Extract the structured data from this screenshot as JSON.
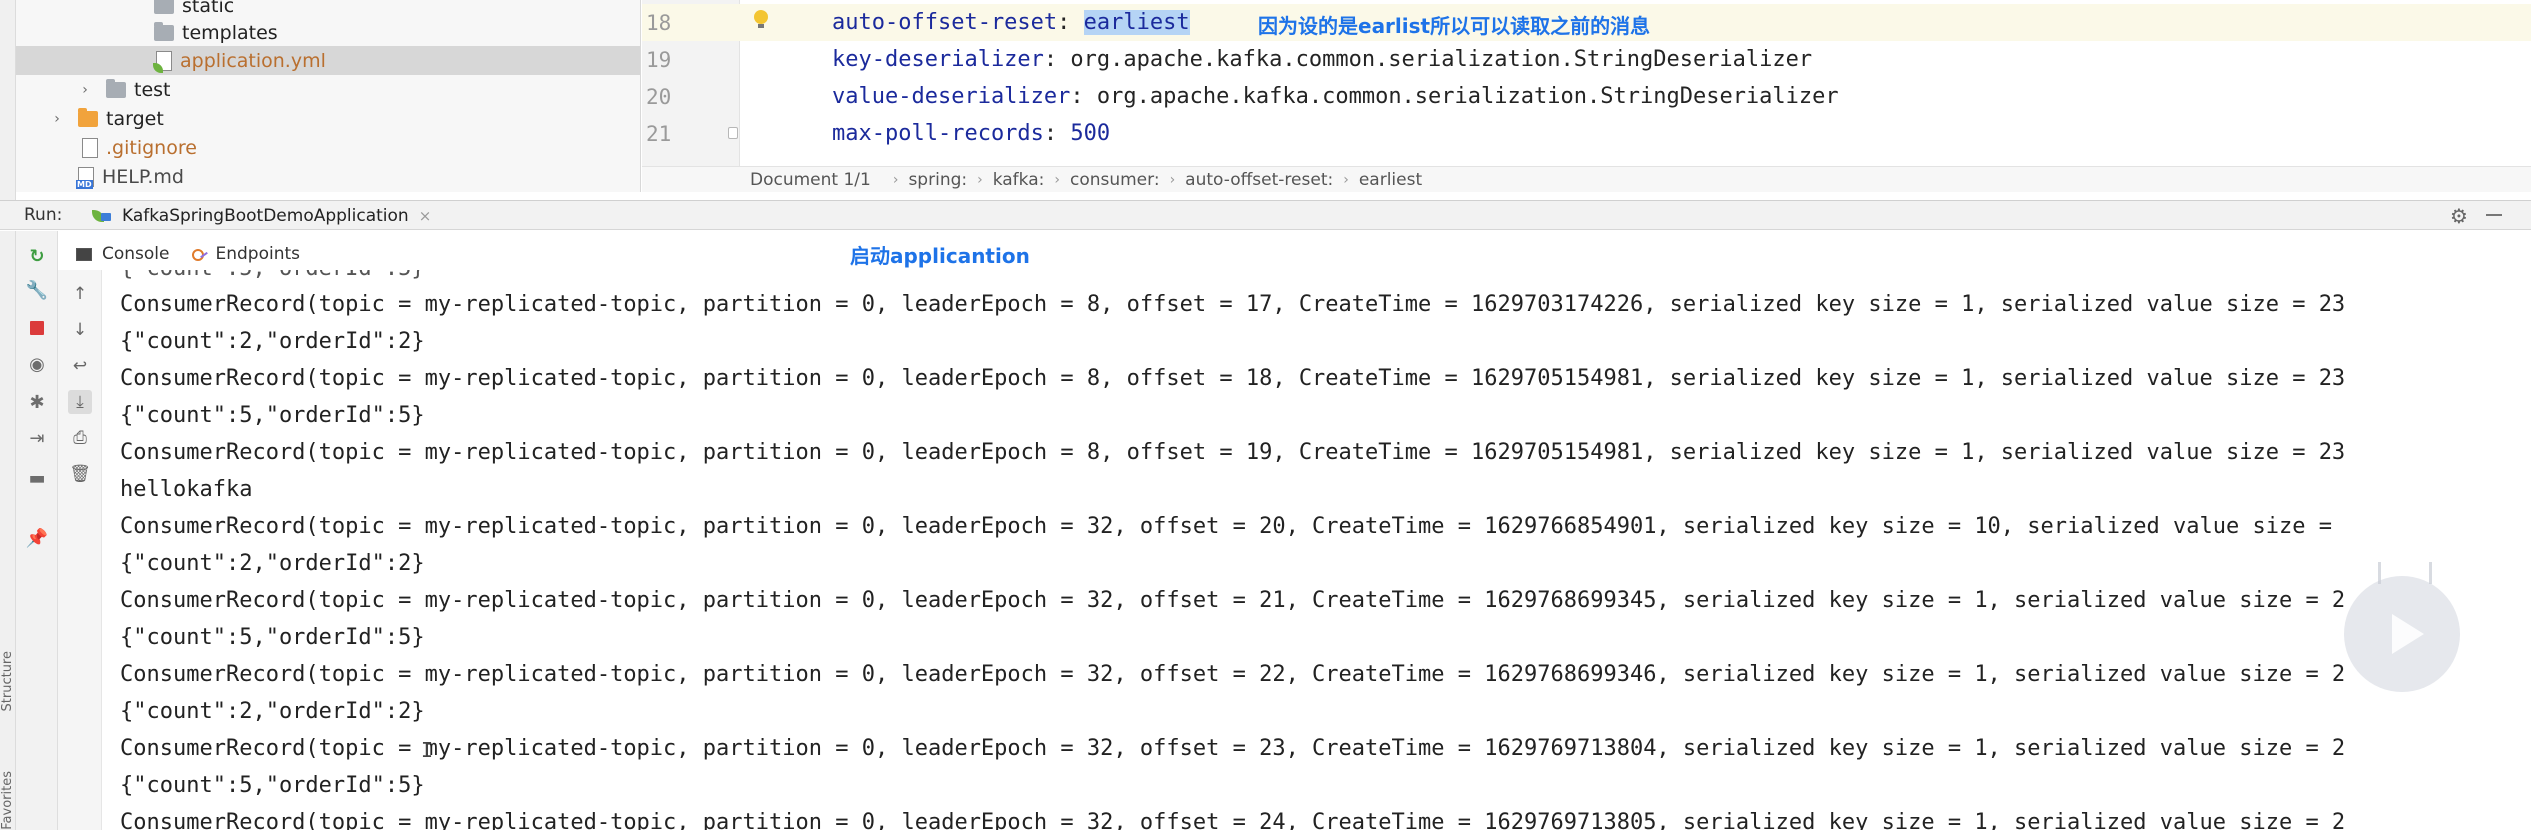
{
  "project_tree": {
    "items": [
      {
        "label": "static",
        "kind": "folder-grey",
        "arrow": ""
      },
      {
        "label": "templates",
        "kind": "folder-grey",
        "arrow": ""
      },
      {
        "label": "application.yml",
        "kind": "yml-file",
        "arrow": ""
      },
      {
        "label": "test",
        "kind": "folder-grey",
        "arrow": "›"
      },
      {
        "label": "target",
        "kind": "folder-orange",
        "arrow": "›"
      },
      {
        "label": ".gitignore",
        "kind": "git-file",
        "arrow": ""
      },
      {
        "label": "HELP.md",
        "kind": "md-file",
        "arrow": ""
      }
    ]
  },
  "editor": {
    "lines": [
      {
        "num": "18",
        "key": "auto-offset-reset",
        "value": "earliest"
      },
      {
        "num": "19",
        "key": "key-deserializer",
        "value": "org.apache.kafka.common.serialization.StringDeserializer"
      },
      {
        "num": "20",
        "key": "value-deserializer",
        "value": "org.apache.kafka.common.serialization.StringDeserializer"
      },
      {
        "num": "21",
        "key": "max-poll-records",
        "value": "500"
      }
    ],
    "annotation": "因为设的是earlist所以可以读取之前的消息"
  },
  "breadcrumb": {
    "document": "Document 1/1",
    "items": [
      "spring:",
      "kafka:",
      "consumer:",
      "auto-offset-reset:",
      "earliest"
    ]
  },
  "run": {
    "label": "Run:",
    "tab_label": "KafkaSpringBootDemoApplication",
    "close": "×",
    "gear_icon": "gear-icon",
    "minimize_icon": "minimize-icon"
  },
  "console_tabs": {
    "console": "Console",
    "endpoints": "Endpoints",
    "annotation": "启动applicantion"
  },
  "left_strip": {
    "structure": "Structure",
    "favorites": "Favorites"
  },
  "console": {
    "lines": [
      "ConsumerRecord(topic = my-replicated-topic, partition = 0, leaderEpoch = 8, offset = 17, CreateTime = 1629703174226, serialized key size = 1, serialized value size = 23",
      "{\"count\":2,\"orderId\":2}",
      "ConsumerRecord(topic = my-replicated-topic, partition = 0, leaderEpoch = 8, offset = 18, CreateTime = 1629705154981, serialized key size = 1, serialized value size = 23",
      "{\"count\":5,\"orderId\":5}",
      "ConsumerRecord(topic = my-replicated-topic, partition = 0, leaderEpoch = 8, offset = 19, CreateTime = 1629705154981, serialized key size = 1, serialized value size = 23",
      "hellokafka",
      "ConsumerRecord(topic = my-replicated-topic, partition = 0, leaderEpoch = 32, offset = 20, CreateTime = 1629766854901, serialized key size = 10, serialized value size =",
      "{\"count\":2,\"orderId\":2}",
      "ConsumerRecord(topic = my-replicated-topic, partition = 0, leaderEpoch = 32, offset = 21, CreateTime = 1629768699345, serialized key size = 1, serialized value size = 2",
      "{\"count\":5,\"orderId\":5}",
      "ConsumerRecord(topic = my-replicated-topic, partition = 0, leaderEpoch = 32, offset = 22, CreateTime = 1629768699346, serialized key size = 1, serialized value size = 2",
      "{\"count\":2,\"orderId\":2}",
      "ConsumerRecord(topic = my-replicated-topic, partition = 0, leaderEpoch = 32, offset = 23, CreateTime = 1629769713804, serialized key size = 1, serialized value size = 2",
      "{\"count\":5,\"orderId\":5}",
      "ConsumerRecord(topic = my-replicated-topic, partition = 0, leaderEpoch = 32, offset = 24, CreateTime = 1629769713805, serialized key size = 1, serialized value size = 2"
    ]
  },
  "colors": {
    "accent": "#1e73e8",
    "stop": "#db3b3b",
    "rerun": "#3e9d42",
    "yaml_key": "#1b2a9c"
  }
}
